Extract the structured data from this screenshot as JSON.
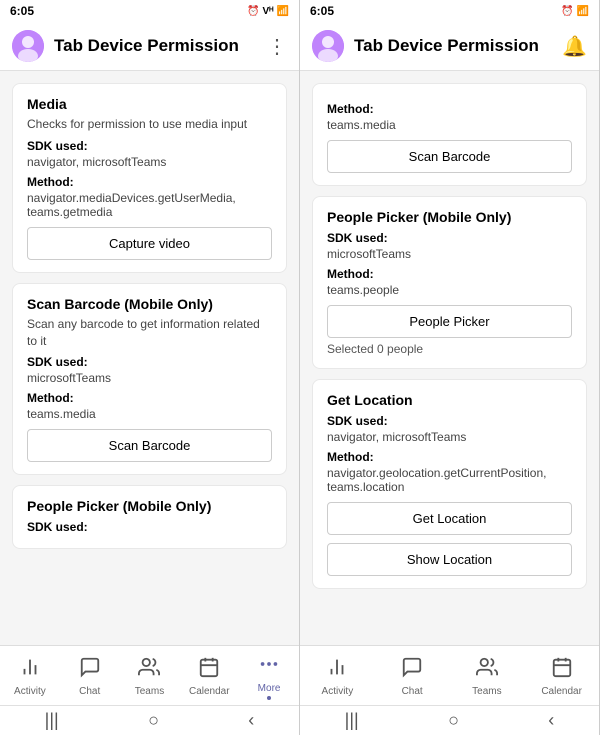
{
  "phones": [
    {
      "id": "left",
      "statusBar": {
        "time": "6:05",
        "icons": "⏰ Vᴴ 📶"
      },
      "titleBar": {
        "title": "Tab Device Permission",
        "menuIcon": "⋮"
      },
      "cards": [
        {
          "id": "media",
          "title": "Media",
          "desc": "Checks for permission to use media input",
          "sdkLabel": "SDK used:",
          "sdkValue": "navigator, microsoftTeams",
          "methodLabel": "Method:",
          "methodValue": "navigator.mediaDevices.getUserMedia, teams.getmedia",
          "button": "Capture video",
          "selectedText": null
        },
        {
          "id": "scan-barcode",
          "title": "Scan Barcode (Mobile Only)",
          "desc": "Scan any barcode to get information related to it",
          "sdkLabel": "SDK used:",
          "sdkValue": "microsoftTeams",
          "methodLabel": "Method:",
          "methodValue": "teams.media",
          "button": "Scan Barcode",
          "selectedText": null
        },
        {
          "id": "people-picker-left",
          "title": "People Picker (Mobile Only)",
          "desc": null,
          "sdkLabel": "SDK used:",
          "sdkValue": "",
          "methodLabel": null,
          "methodValue": null,
          "button": null,
          "selectedText": null,
          "partial": true
        }
      ],
      "navItems": [
        {
          "id": "activity",
          "label": "Activity",
          "icon": "🔔",
          "active": false
        },
        {
          "id": "chat",
          "label": "Chat",
          "icon": "💬",
          "active": false
        },
        {
          "id": "teams",
          "label": "Teams",
          "icon": "👥",
          "active": false
        },
        {
          "id": "calendar",
          "label": "Calendar",
          "icon": "📅",
          "active": false
        },
        {
          "id": "more",
          "label": "More",
          "icon": "···",
          "active": true,
          "showDot": true
        }
      ]
    },
    {
      "id": "right",
      "statusBar": {
        "time": "6:05",
        "icons": "⏰ 📶"
      },
      "titleBar": {
        "title": "Tab Device Permission",
        "menuIcon": "🔔"
      },
      "cards": [
        {
          "id": "scan-barcode-right",
          "title": null,
          "desc": null,
          "methodLabel": "Method:",
          "methodValue": "teams.media",
          "button": "Scan Barcode",
          "selectedText": null,
          "partial": true,
          "topOnly": true
        },
        {
          "id": "people-picker-right",
          "title": "People Picker (Mobile Only)",
          "desc": null,
          "sdkLabel": "SDK used:",
          "sdkValue": "microsoftTeams",
          "methodLabel": "Method:",
          "methodValue": "teams.people",
          "button": "People Picker",
          "selectedText": "Selected 0 people"
        },
        {
          "id": "get-location",
          "title": "Get Location",
          "desc": null,
          "sdkLabel": "SDK used:",
          "sdkValue": "navigator, microsoftTeams",
          "methodLabel": "Method:",
          "methodValue": "navigator.geolocation.getCurrentPosition, teams.location",
          "button": "Get Location",
          "button2": "Show Location",
          "selectedText": null
        }
      ],
      "navItems": [
        {
          "id": "activity",
          "label": "Activity",
          "icon": "🔔",
          "active": false
        },
        {
          "id": "chat",
          "label": "Chat",
          "icon": "💬",
          "active": false
        },
        {
          "id": "teams",
          "label": "Teams",
          "icon": "👥",
          "active": false
        },
        {
          "id": "calendar",
          "label": "Calendar",
          "icon": "📅",
          "active": false
        }
      ]
    }
  ]
}
